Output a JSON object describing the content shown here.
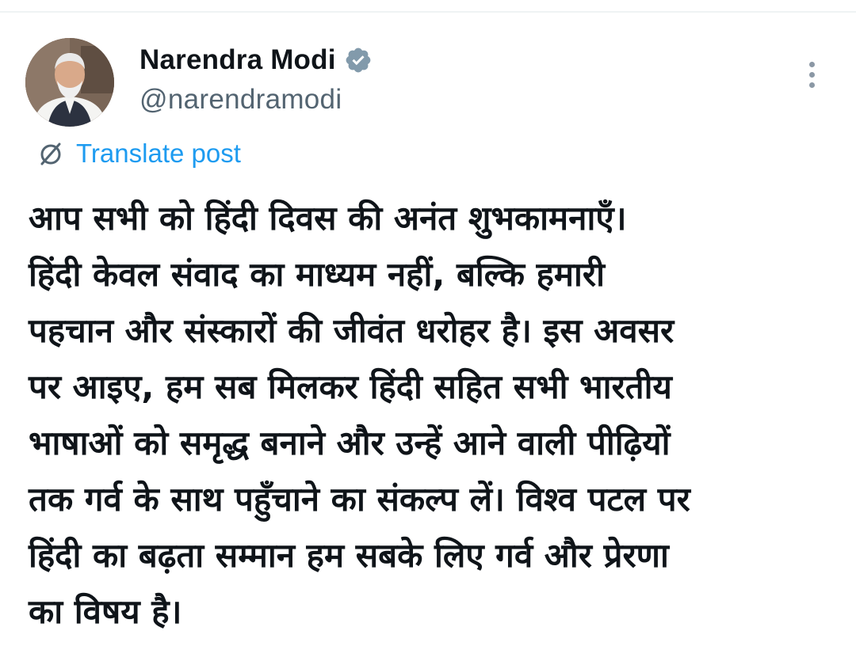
{
  "post": {
    "author": {
      "name": "Narendra Modi",
      "handle": "@narendramodi",
      "verified": true
    },
    "translate_label": "Translate post",
    "text_lines": [
      "आप सभी को हिंदी दिवस की अनंत शुभकामनाएँ।",
      "हिंदी केवल संवाद का माध्यम नहीं, बल्कि हमारी",
      "पहचान और संस्कारों की जीवंत धरोहर है। इस अवसर",
      "पर आइए, हम सब मिलकर हिंदी सहित सभी भारतीय",
      "भाषाओं को समृद्ध बनाने और उन्हें आने वाली पीढ़ियों",
      "तक गर्व के साथ पहुँचाने का संकल्प लें। विश्व पटल पर",
      "हिंदी का बढ़ता सम्मान हम सबके लिए गर्व और प्रेरणा",
      "का विषय है।"
    ]
  },
  "icons": {
    "verified": "verified-badge-icon",
    "translate": "globe-translate-icon",
    "more": "more-options-icon"
  },
  "colors": {
    "text": "#0f1419",
    "secondary": "#536471",
    "link": "#1d9bf0",
    "verified_badge": "#829aab"
  }
}
